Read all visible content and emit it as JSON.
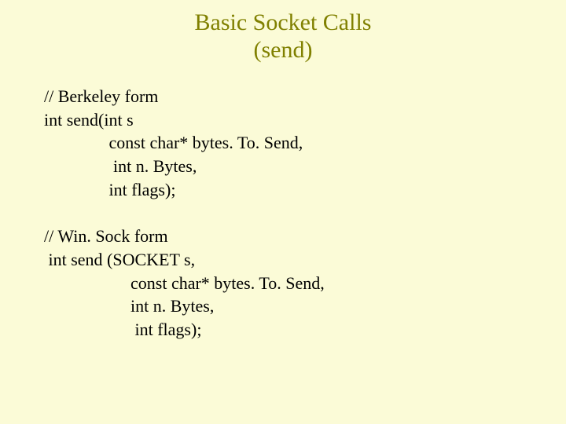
{
  "title": {
    "line1": "Basic Socket Calls",
    "line2": "(send)"
  },
  "code": {
    "b_comment": "// Berkeley form",
    "b_sig": "int send(int s",
    "b_p1": "               const char* bytes. To. Send,",
    "b_p2": "                int n. Bytes,",
    "b_p3": "               int flags);",
    "blank": " ",
    "w_comment": "// Win. Sock form",
    "w_sig": " int send (SOCKET s,",
    "w_p1": "                    const char* bytes. To. Send,",
    "w_p2": "                    int n. Bytes,",
    "w_p3": "                     int flags);"
  }
}
